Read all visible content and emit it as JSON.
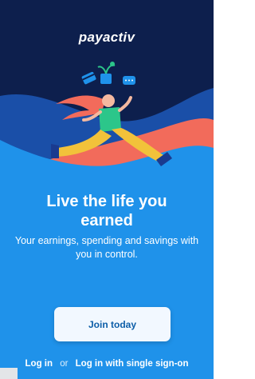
{
  "app": {
    "logo_text": "payactiv"
  },
  "welcome": {
    "headline_line1": "Live the life you",
    "headline_line2": "earned",
    "subtext_line1": "Your earnings, spending and savings with",
    "subtext_line2": "you in control."
  },
  "actions": {
    "join_label": "Join today",
    "login_label": "Log in",
    "or_text": "or",
    "sso_label": "Log in with single sign-on"
  },
  "colors": {
    "background": "#1f92ea",
    "hero_dark": "#0d1f4d",
    "accent_orange": "#f26b5b",
    "button_text": "#0d5ea8"
  }
}
